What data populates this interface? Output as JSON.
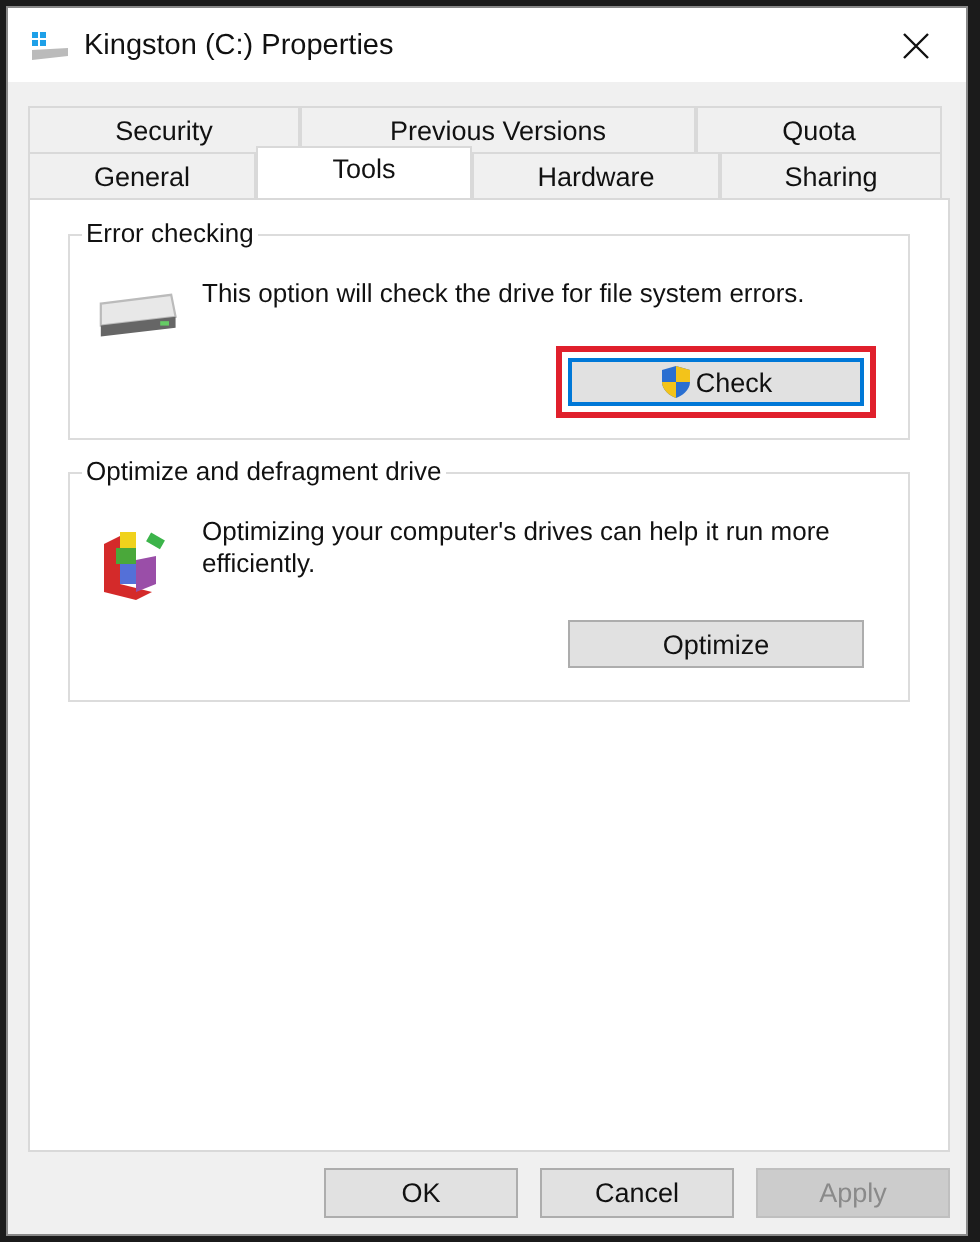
{
  "window": {
    "title": "Kingston (C:) Properties"
  },
  "tab_rows": [
    [
      {
        "label": "Security",
        "selected": false
      },
      {
        "label": "Previous Versions",
        "selected": false
      },
      {
        "label": "Quota",
        "selected": false
      }
    ],
    [
      {
        "label": "General",
        "selected": false
      },
      {
        "label": "Tools",
        "selected": true
      },
      {
        "label": "Hardware",
        "selected": false
      },
      {
        "label": "Sharing",
        "selected": false
      }
    ]
  ],
  "groups": [
    {
      "kind": "drive",
      "title": "Error checking",
      "text": "This option will check the drive for file system errors.",
      "button": {
        "label": "Check",
        "shield": true,
        "focused": true,
        "highlighted": true
      }
    },
    {
      "kind": "defrag",
      "title": "Optimize and defragment drive",
      "text": "Optimizing your computer's drives can help it run more efficiently.",
      "button": {
        "label": "Optimize",
        "shield": false,
        "focused": false,
        "highlighted": false
      }
    }
  ],
  "buttons": [
    {
      "label": "OK",
      "disabled": false
    },
    {
      "label": "Cancel",
      "disabled": false
    },
    {
      "label": "Apply",
      "disabled": true
    }
  ]
}
